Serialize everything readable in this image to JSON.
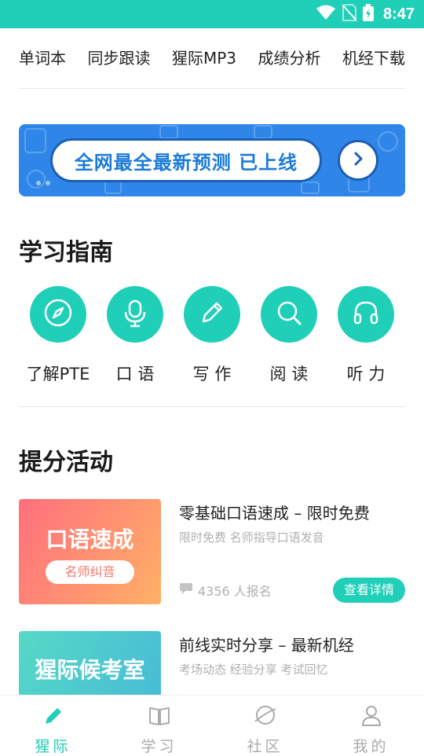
{
  "status_bar": {
    "time": "8:47",
    "background": "#1fcfb8"
  },
  "quick_nav": [
    "单词本",
    "同步跟读",
    "猩际MP3",
    "成绩分析",
    "机经下载"
  ],
  "banner": {
    "text": "全网最全最新预测 已上线",
    "icon": "chevron-right-icon"
  },
  "guide": {
    "title": "学习指南",
    "items": [
      {
        "label": "了解PTE",
        "icon": "compass-icon"
      },
      {
        "label": "口 语",
        "icon": "microphone-icon"
      },
      {
        "label": "写 作",
        "icon": "pencil-icon"
      },
      {
        "label": "阅 读",
        "icon": "search-icon"
      },
      {
        "label": "听 力",
        "icon": "headphones-icon"
      }
    ]
  },
  "activities": {
    "title": "提分活动",
    "items": [
      {
        "thumb_title": "口语速成",
        "thumb_tag": "名师纠音",
        "title": "零基础口语速成 – 限时免费",
        "subtitle": "限时免费  名师指导口语发音",
        "count": "4356 人报名",
        "cta": "查看详情"
      },
      {
        "thumb_title": "猩际候考室",
        "thumb_tag": "",
        "title": "前线实时分享 – 最新机经",
        "subtitle": "考场动态  经验分享  考试回忆"
      }
    ]
  },
  "tabbar": [
    {
      "label": "猩际",
      "icon": "pencil-icon",
      "active": true
    },
    {
      "label": "学习",
      "icon": "book-icon",
      "active": false
    },
    {
      "label": "社区",
      "icon": "planet-icon",
      "active": false
    },
    {
      "label": "我的",
      "icon": "person-icon",
      "active": false
    }
  ],
  "colors": {
    "accent": "#1fcfb8",
    "banner": "#2f86e8"
  }
}
